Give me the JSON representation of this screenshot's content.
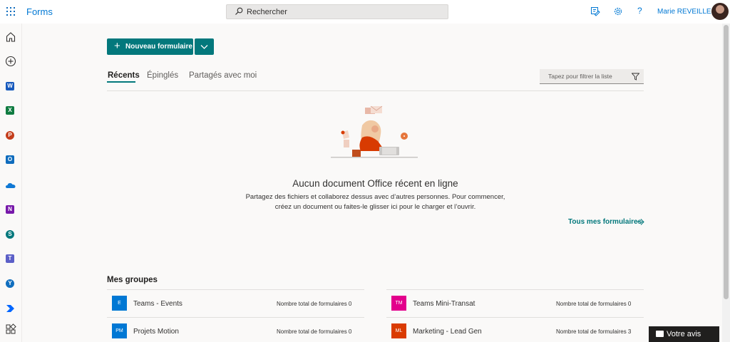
{
  "header": {
    "app_name": "Forms",
    "search_placeholder": "Rechercher",
    "user_name": "Marie REVEILLERE",
    "help_glyph": "?",
    "icons": [
      "app-launcher-icon",
      "search-icon",
      "feedback-edit-icon",
      "gear-icon",
      "help-icon",
      "avatar"
    ]
  },
  "rail": {
    "items": [
      {
        "name": "home",
        "icon": "home-icon"
      },
      {
        "name": "create",
        "icon": "add-circle-icon"
      },
      {
        "name": "word",
        "icon": "word-icon",
        "letter": "W",
        "color": "#185abd"
      },
      {
        "name": "excel",
        "icon": "excel-icon",
        "letter": "X",
        "color": "#107c41"
      },
      {
        "name": "powerpoint",
        "icon": "powerpoint-icon",
        "letter": "P",
        "color": "#c43e1c"
      },
      {
        "name": "outlook",
        "icon": "outlook-icon",
        "letter": "O",
        "color": "#0f6cbd"
      },
      {
        "name": "onedrive",
        "icon": "onedrive-icon"
      },
      {
        "name": "onenote",
        "icon": "onenote-icon",
        "letter": "N",
        "color": "#7719aa"
      },
      {
        "name": "sharepoint",
        "icon": "sharepoint-icon",
        "letter": "S",
        "color": "#03787c"
      },
      {
        "name": "teams",
        "icon": "teams-icon",
        "letter": "T",
        "color": "#5b5fc7"
      },
      {
        "name": "yammer",
        "icon": "yammer-icon",
        "letter": "Y",
        "color": "#106ebe"
      },
      {
        "name": "power-automate",
        "icon": "power-automate-icon"
      },
      {
        "name": "all-apps",
        "icon": "all-apps-icon"
      }
    ]
  },
  "main": {
    "new_form_label": "Nouveau formulaire",
    "tabs": [
      {
        "label": "Récents",
        "active": true
      },
      {
        "label": "Épinglés",
        "active": false
      },
      {
        "label": "Partagés avec moi",
        "active": false
      }
    ],
    "filter_placeholder": "Tapez pour filtrer la liste",
    "empty_title": "Aucun document Office récent en ligne",
    "empty_line1": "Partagez des fichiers et collaborez dessus avec d’autres personnes. Pour commencer,",
    "empty_line2": "créez un document ou faites-le glisser ici pour le charger et l’ouvrir.",
    "all_forms_link": "Tous mes formulaires"
  },
  "groups": {
    "title": "Mes groupes",
    "items": [
      {
        "initials": "E",
        "name": "Teams - Events",
        "count_label": "Nombre total de formulaires 0",
        "color": "#0078d4"
      },
      {
        "initials": "TM",
        "name": "Teams Mini-Transat",
        "count_label": "Nombre total de formulaires 0",
        "color": "#e3008c"
      },
      {
        "initials": "PM",
        "name": "Projets Motion",
        "count_label": "Nombre total de formulaires 0",
        "color": "#0078d4"
      },
      {
        "initials": "ML",
        "name": "Marketing - Lead Gen",
        "count_label": "Nombre total de formulaires 3",
        "color": "#da3b01"
      }
    ]
  },
  "feedback": {
    "label": "Votre avis"
  },
  "colors": {
    "accent": "#03787c",
    "link": "#0078d4"
  }
}
